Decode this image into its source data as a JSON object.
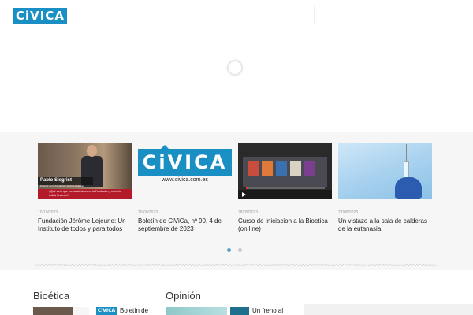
{
  "header": {
    "logo_text": "CiVICA"
  },
  "carousel": {
    "cards": [
      {
        "date": "10/10/2023",
        "title": "Fundación Jérôme Lejeune: Un Instituto de todos y para todos",
        "thumb": {
          "name": "Pablo Siegrist",
          "role": "Director de la Fundación Jérôme Lejeune",
          "question": "¿Qué es lo que preparáis ahora en la Fundación y cómo lo estáis llevando?"
        }
      },
      {
        "date": "25/09/2023",
        "title": "Boletín de CiViCa, nº 90, 4 de septiembre de 2023",
        "thumb": {
          "logo": "CiVICA",
          "url": "www.civica.com.es"
        }
      },
      {
        "date": "28/09/2023",
        "title": "Curso de Iniciacion a la Bioetica (on line)"
      },
      {
        "date": "27/09/2023",
        "title": "Un vistazo a la sala de calderas de la eutanasia"
      }
    ],
    "pagination": {
      "count": 2,
      "active": 0
    }
  },
  "sections": {
    "bioetica": {
      "title": "Bioética",
      "teaser": "Boletín de",
      "thumb_logo": "CiVICA"
    },
    "opinion": {
      "title": "Opinión",
      "teaser": "Un freno al"
    }
  },
  "colors": {
    "brand_blue": "#1a8fc4",
    "dot_active": "#5a9fc0",
    "dot_inactive": "#c8c8c8",
    "carousel_bg": "#f6f6f6"
  }
}
